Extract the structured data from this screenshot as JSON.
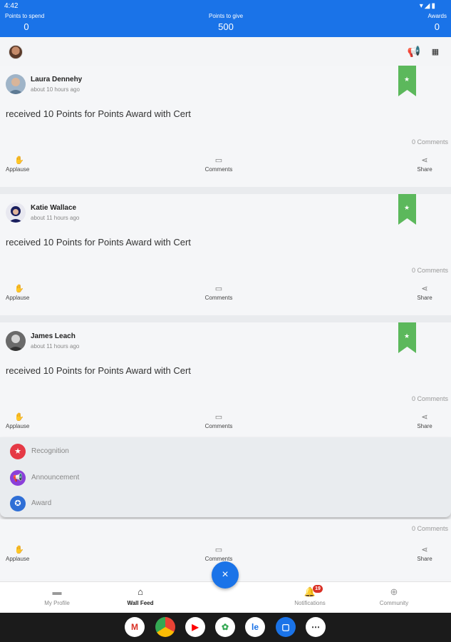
{
  "status_bar": {
    "time": "4:42",
    "icons": "▾◢▮"
  },
  "stats": {
    "spend": {
      "label": "Points to spend",
      "value": "0"
    },
    "give": {
      "label": "Points to give",
      "value": "500"
    },
    "awards": {
      "label": "Awards",
      "value": "0"
    }
  },
  "header": {
    "megaphone_icon": "megaphone-icon",
    "grid_icon": "grid-icon"
  },
  "posts": [
    {
      "name": "Laura Dennehy",
      "time": "about 10 hours ago",
      "message": "received 10 Points for Points Award with Cert",
      "comments_count": "0 Comments",
      "applause": "Applause",
      "comments": "Comments",
      "share": "Share"
    },
    {
      "name": "Katie Wallace",
      "time": "about 11 hours ago",
      "message": "received 10 Points for Points Award with Cert",
      "comments_count": "0 Comments",
      "applause": "Applause",
      "comments": "Comments",
      "share": "Share"
    },
    {
      "name": "James Leach",
      "time": "about 11 hours ago",
      "message": "received 10 Points for Points Award with Cert",
      "comments_count": "0 Comments",
      "applause": "Applause",
      "comments": "Comments",
      "share": "Share"
    },
    {
      "comments_count": "0 Comments",
      "applause": "Applause",
      "comments": "Comments",
      "share": "Share"
    }
  ],
  "menu": [
    {
      "label": "Recognition",
      "icon": "star-icon",
      "color": "#e53945"
    },
    {
      "label": "Announcement",
      "icon": "megaphone-icon",
      "color": "#8b3fd9"
    },
    {
      "label": "Award",
      "icon": "award-icon",
      "color": "#2f6fd6"
    }
  ],
  "fab": {
    "label": "×"
  },
  "nav": [
    {
      "label": "My Profile"
    },
    {
      "label": "Wall Feed"
    },
    {
      "label": "Notifications",
      "badge": "19"
    },
    {
      "label": "Community"
    }
  ],
  "colors": {
    "primary": "#1a73e8",
    "ribbon": "#5cb85c",
    "badge": "#d93025"
  }
}
